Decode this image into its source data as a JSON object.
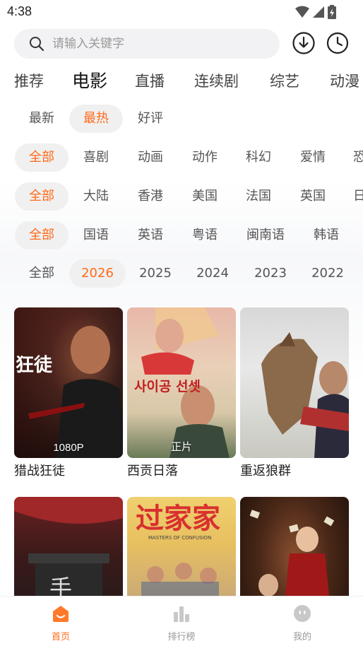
{
  "status_bar": {
    "time": "4:38"
  },
  "search": {
    "placeholder": "请输入关键字"
  },
  "main_tabs": [
    {
      "label": "推荐"
    },
    {
      "label": "电影",
      "active": true
    },
    {
      "label": "直播"
    },
    {
      "label": "连续剧"
    },
    {
      "label": "综艺"
    },
    {
      "label": "动漫"
    }
  ],
  "filters": {
    "sort": [
      "最新",
      "最热",
      "好评"
    ],
    "genre": [
      "全部",
      "喜剧",
      "动画",
      "动作",
      "科幻",
      "爱情",
      "恐"
    ],
    "region": [
      "全部",
      "大陆",
      "香港",
      "美国",
      "法国",
      "英国",
      "日"
    ],
    "language": [
      "全部",
      "国语",
      "英语",
      "粤语",
      "闽南语",
      "韩语"
    ],
    "year": [
      "全部",
      "2026",
      "2025",
      "2024",
      "2023",
      "2022"
    ]
  },
  "movies": [
    {
      "title": "猎战狂徒",
      "badge": "1080P"
    },
    {
      "title": "西贡日落",
      "badge": "正片"
    },
    {
      "title": "重返狼群",
      "badge": ""
    },
    {
      "title": "",
      "badge": ""
    },
    {
      "title": "",
      "badge": ""
    },
    {
      "title": "",
      "badge": ""
    }
  ],
  "poster_text": {
    "korean_title": "사이공 선셋",
    "guojiajia": "过家家",
    "guojiajia_en": "MASTERS OF CONFUSION"
  },
  "bottom_nav": [
    {
      "label": "首页",
      "icon": "home-icon",
      "active": true
    },
    {
      "label": "排行榜",
      "icon": "ranking-icon"
    },
    {
      "label": "我的",
      "icon": "profile-icon"
    }
  ],
  "colors": {
    "accent": "#ff6a1a",
    "chip_bg": "#f0f0f0"
  }
}
